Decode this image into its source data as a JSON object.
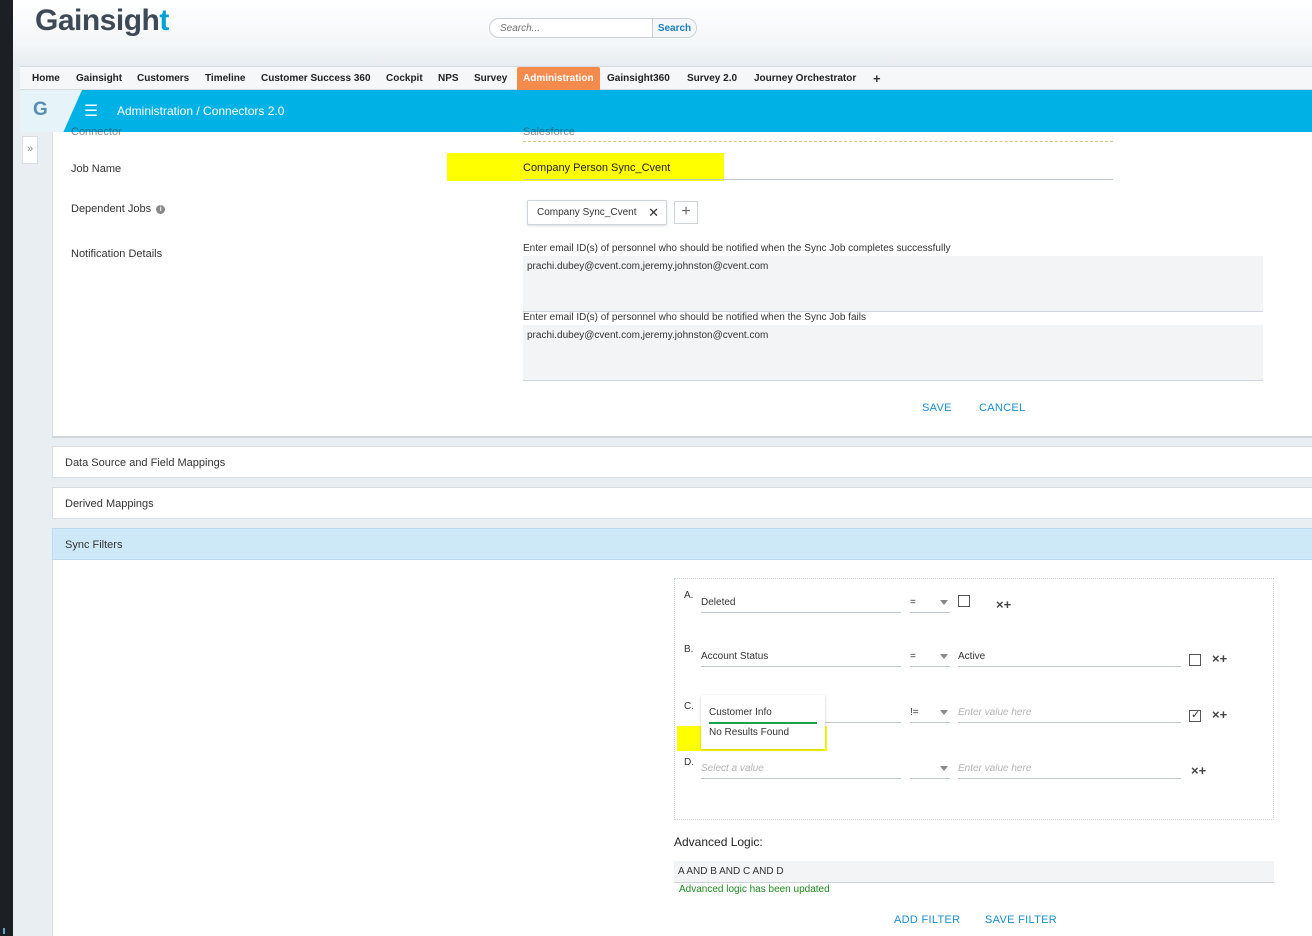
{
  "app": {
    "logo_main": "Gainsigh",
    "logo_accent": "t"
  },
  "search": {
    "placeholder": "Search...",
    "button_label": "Search"
  },
  "nav": {
    "tabs": [
      "Home",
      "Gainsight",
      "Customers",
      "Timeline",
      "Customer Success 360",
      "Cockpit",
      "NPS",
      "Survey",
      "Administration",
      "Gainsight360",
      "Survey 2.0",
      "Journey Orchestrator"
    ],
    "active_tab": "Administration",
    "add_label": "+"
  },
  "header": {
    "logo_letter": "G",
    "menu_icon": "☰",
    "breadcrumb": "Administration / Connectors 2.0"
  },
  "side_toggle": {
    "label": "»"
  },
  "form": {
    "connector_label": "Connector",
    "connector_value": "Salesforce",
    "job_name_label": "Job Name",
    "job_name_value": "Company Person Sync_Cvent",
    "dependent_jobs_label": "Dependent Jobs",
    "dependent_job_chip": "Company Sync_Cvent",
    "notification_label": "Notification Details",
    "success_prompt": "Enter email ID(s) of personnel who should be notified when the Sync Job completes successfully",
    "success_emails": "prachi.dubey@cvent.com,jeremy.johnston@cvent.com",
    "fail_prompt": "Enter email ID(s) of personnel who should be notified when the Sync Job fails",
    "fail_emails": "prachi.dubey@cvent.com,jeremy.johnston@cvent.com",
    "save_label": "SAVE",
    "cancel_label": "CANCEL"
  },
  "sections": {
    "data_source": "Data Source and Field Mappings",
    "derived": "Derived Mappings",
    "sync_filters": "Sync Filters"
  },
  "filters": {
    "rows": [
      {
        "letter": "A.",
        "field": "Deleted",
        "operator": "=",
        "value": "",
        "value_placeholder": "",
        "checked": false
      },
      {
        "letter": "B.",
        "field": "Account Status",
        "operator": "=",
        "value": "Active",
        "value_placeholder": "",
        "checked": false
      },
      {
        "letter": "C.",
        "field": "Customer Info",
        "operator": "!=",
        "value": "",
        "value_placeholder": "Enter value here",
        "checked": true
      },
      {
        "letter": "D.",
        "field": "",
        "field_placeholder": "Select a value",
        "operator": "",
        "value": "",
        "value_placeholder": "Enter value here",
        "checked": false
      }
    ],
    "dropdown_no_results": "No Results Found",
    "row_actions": "×+",
    "advanced_logic_title": "Advanced Logic:",
    "advanced_logic_value": "A AND B AND C AND D",
    "advanced_logic_msg": "Advanced logic has been updated",
    "add_filter_label": "ADD FILTER",
    "save_filter_label": "SAVE FILTER"
  }
}
